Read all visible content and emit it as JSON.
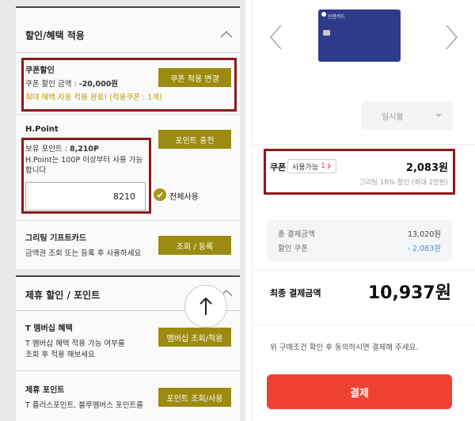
{
  "left": {
    "discount_section": {
      "title": "할인/혜택 적용"
    },
    "coupon": {
      "title": "쿠폰할인",
      "amount_label": "쿠폰 할인 금액 : ",
      "amount_value": "-20,000원",
      "auto_note": "최대 혜택 자동 적용 완료! (적용쿠폰 : 1개)",
      "change_button": "쿠폰 적용 변경"
    },
    "hpoint": {
      "title": "H.Point",
      "balance_label": "보유 포인트 : ",
      "balance_value": "8,210P",
      "note": "H.Point는 100P 이상부터 사용 가능합니다",
      "charge_button": "포인트 충전",
      "input_value": "8210",
      "use_all_label": "전체사용"
    },
    "giftcard": {
      "title": "그리팅 기프트카드",
      "note": "금액권 조회 또는 등록 후 사용하세요",
      "button": "조회 / 등록"
    },
    "partner_section": {
      "title": "제휴 할인 / 포인트",
      "tmembership": {
        "title": "T 멤버십 혜택",
        "note_line1": "T 멤버십 혜택 적용 가능 여부를",
        "note_line2": "조회 후 적용 해보세요",
        "button": "멤버십 조회/적용"
      },
      "partner_point": {
        "title": "제휴 포인트",
        "note": "T 플러스포인트, 블루멤버스 포인트를",
        "button": "포인트 조회/사용"
      }
    }
  },
  "right": {
    "card": {
      "brand": "신한카드"
    },
    "installment": {
      "selected": "일시불"
    },
    "coupon": {
      "label": "쿠폰",
      "badge_text": "사용가능",
      "badge_count": "1",
      "amount": "2,083원",
      "note": "그리팅 16% 할인 (최대 2만원)"
    },
    "summary": {
      "total_label": "총 결제금액",
      "total_value": "13,020원",
      "coupon_label": "할인 쿠폰",
      "coupon_value": "- 2,083원"
    },
    "final": {
      "label": "최종 결제금액",
      "amount": "10,937",
      "unit": "원"
    },
    "agree_text": "위 구매조건 확인 후 동의하시면 결제해 주세요.",
    "pay_button": "결제"
  },
  "colors": {
    "olive_button": "#9c8b11",
    "highlight_box": "#8b1a1a",
    "pay_red": "#ef4133",
    "card_navy": "#2d3b8a"
  }
}
